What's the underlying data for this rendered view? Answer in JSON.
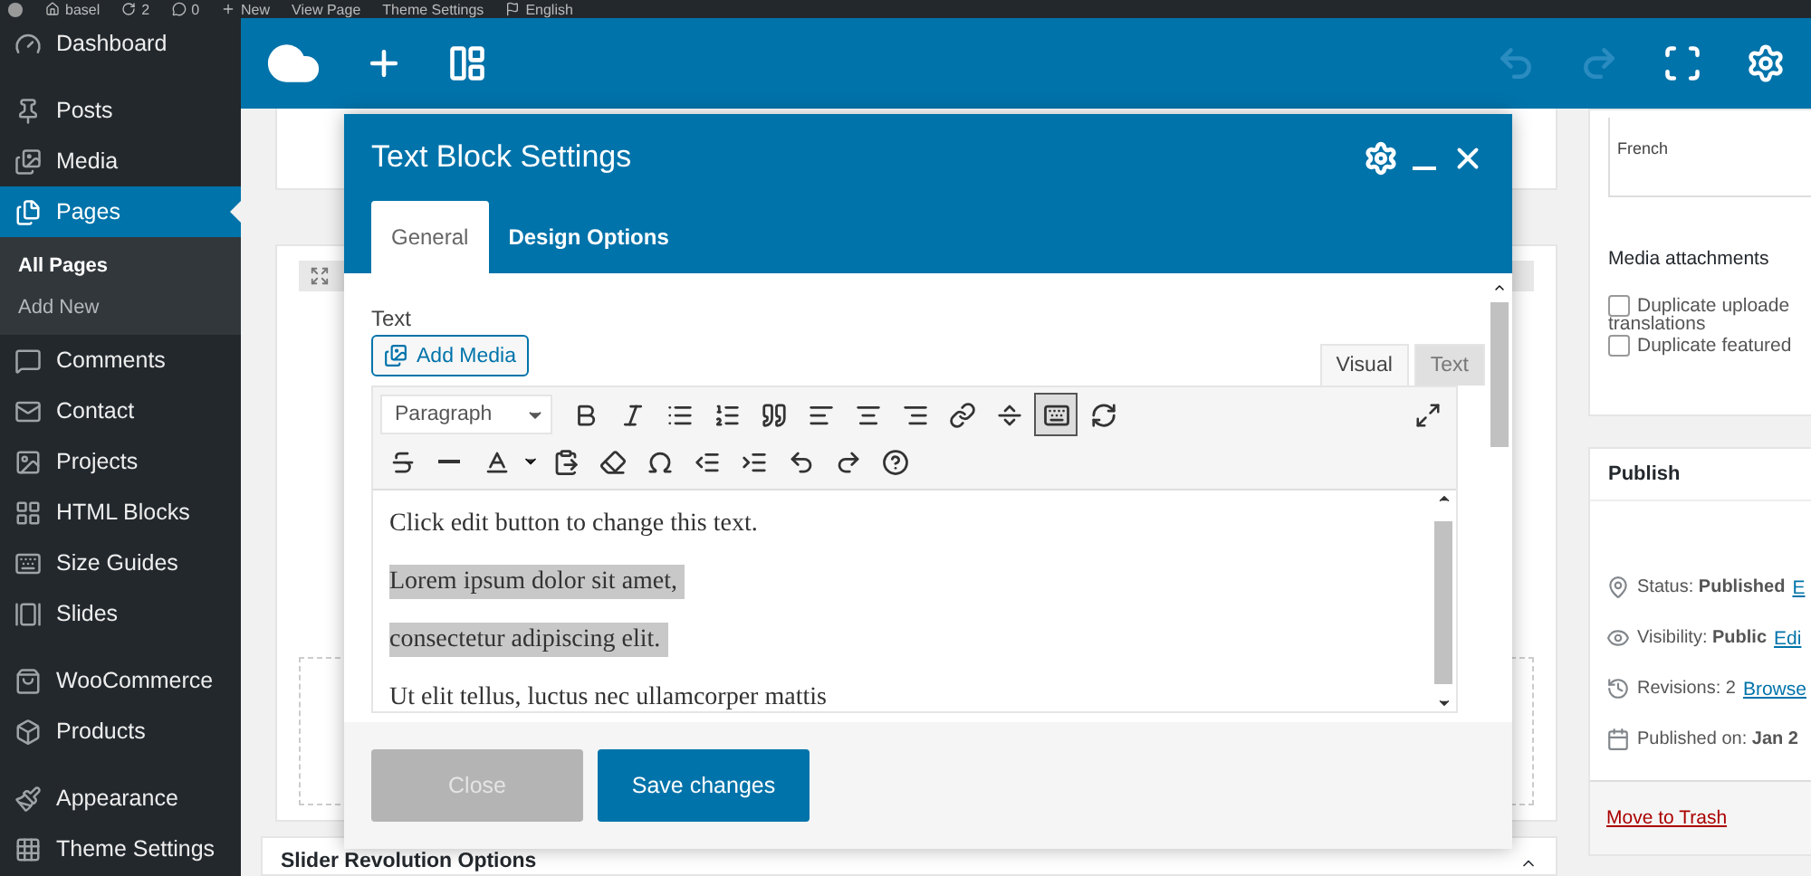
{
  "admin_bar": {
    "items": [
      {
        "kind": "logo"
      },
      {
        "kind": "home",
        "label": "basel"
      },
      {
        "kind": "updates",
        "label": "2"
      },
      {
        "kind": "comments",
        "label": "0"
      },
      {
        "kind": "new",
        "label": "New"
      },
      {
        "kind": "text",
        "label": "View Page"
      },
      {
        "kind": "text",
        "label": "Theme Settings"
      },
      {
        "kind": "language",
        "label": "English"
      }
    ]
  },
  "sidebar": {
    "groups": [
      {
        "items": [
          {
            "label": "Dashboard",
            "selected": false
          }
        ]
      },
      {
        "items": [
          {
            "label": "Posts",
            "selected": false
          },
          {
            "label": "Media",
            "selected": false
          },
          {
            "label": "Pages",
            "selected": true,
            "children": [
              {
                "label": "All Pages",
                "selected": true
              },
              {
                "label": "Add New",
                "selected": false
              }
            ]
          },
          {
            "label": "Comments",
            "selected": false
          },
          {
            "label": "Contact",
            "selected": false
          },
          {
            "label": "Projects",
            "selected": false
          },
          {
            "label": "HTML Blocks",
            "selected": false
          },
          {
            "label": "Size Guides",
            "selected": false
          },
          {
            "label": "Slides",
            "selected": false
          }
        ]
      },
      {
        "items": [
          {
            "label": "WooCommerce",
            "selected": false
          },
          {
            "label": "Products",
            "selected": false
          }
        ]
      },
      {
        "items": [
          {
            "label": "Appearance",
            "selected": false
          },
          {
            "label": "Theme Settings",
            "selected": false
          }
        ]
      }
    ]
  },
  "builder_toolbar": {
    "buttons": [
      {
        "kind": "logo",
        "disabled": false
      },
      {
        "kind": "add",
        "disabled": false
      },
      {
        "kind": "layout",
        "disabled": false
      },
      {
        "kind": "undo",
        "disabled": true
      },
      {
        "kind": "redo",
        "disabled": true
      },
      {
        "kind": "fullscreen",
        "disabled": false
      },
      {
        "kind": "settings",
        "disabled": false
      }
    ]
  },
  "content": {
    "bottom_panel": {
      "title": "Slider Revolution Options"
    }
  },
  "modal": {
    "title": "Text Block Settings",
    "tabs": [
      {
        "label": "General",
        "selected": true
      },
      {
        "label": "Design Options",
        "selected": false
      }
    ],
    "field_label": "Text",
    "add_media": "Add Media",
    "editor_tabs": [
      {
        "label": "Visual",
        "selected": true
      },
      {
        "label": "Text",
        "selected": false
      }
    ],
    "format_select": "Paragraph",
    "toolbar_rows": [
      [
        {
          "kind": "bold",
          "pressed": false
        },
        {
          "kind": "italic",
          "pressed": false
        },
        {
          "kind": "bullets",
          "pressed": false
        },
        {
          "kind": "numbers",
          "pressed": false
        },
        {
          "kind": "quote",
          "pressed": false
        },
        {
          "kind": "align-left",
          "pressed": false
        },
        {
          "kind": "align-center",
          "pressed": false
        },
        {
          "kind": "align-right",
          "pressed": false
        },
        {
          "kind": "link",
          "pressed": false
        },
        {
          "kind": "more",
          "pressed": false
        },
        {
          "kind": "toolbar-toggle",
          "pressed": true
        },
        {
          "kind": "refresh",
          "pressed": false
        }
      ],
      [
        {
          "kind": "strikethrough",
          "pressed": false
        },
        {
          "kind": "hr",
          "pressed": false
        },
        {
          "kind": "text-color",
          "pressed": false
        },
        {
          "kind": "paste",
          "pressed": false
        },
        {
          "kind": "eraser",
          "pressed": false
        },
        {
          "kind": "omega",
          "pressed": false
        },
        {
          "kind": "outdent",
          "pressed": false
        },
        {
          "kind": "indent",
          "pressed": false
        },
        {
          "kind": "undo",
          "pressed": false
        },
        {
          "kind": "redo",
          "pressed": false
        },
        {
          "kind": "help",
          "pressed": false
        }
      ]
    ],
    "paragraphs": [
      {
        "text": "Click edit button to change this text.",
        "highlighted": false
      },
      {
        "text": "Lorem ipsum dolor sit amet,",
        "highlighted": true
      },
      {
        "text": "consectetur adipiscing elit.",
        "highlighted": true
      },
      {
        "text": "Ut elit tellus, luctus nec ullamcorper mattis",
        "highlighted": false
      }
    ],
    "buttons": [
      {
        "label": "Close",
        "kind": "secondary",
        "disabled": true
      },
      {
        "label": "Save changes",
        "kind": "primary",
        "disabled": false
      }
    ]
  },
  "right_column": {
    "language_field": {
      "value": "French"
    },
    "media_attachments": {
      "title": "Media attachments",
      "checkboxes": [
        {
          "label": "Duplicate uploade",
          "continuation": "translations",
          "checked": false
        },
        {
          "label": "Duplicate featured",
          "checked": false
        }
      ]
    },
    "publish": {
      "title": "Publish",
      "rows": [
        {
          "kind": "status",
          "label": "Status:",
          "value": "Published",
          "link": "E"
        },
        {
          "kind": "visibility",
          "label": "Visibility:",
          "value": "Public",
          "link": "Edi"
        },
        {
          "kind": "revisions",
          "label": "Revisions: 2",
          "link": "Browse"
        },
        {
          "kind": "date",
          "label": "Published on:",
          "value": "Jan 2"
        }
      ],
      "trash": "Move to Trash"
    }
  }
}
